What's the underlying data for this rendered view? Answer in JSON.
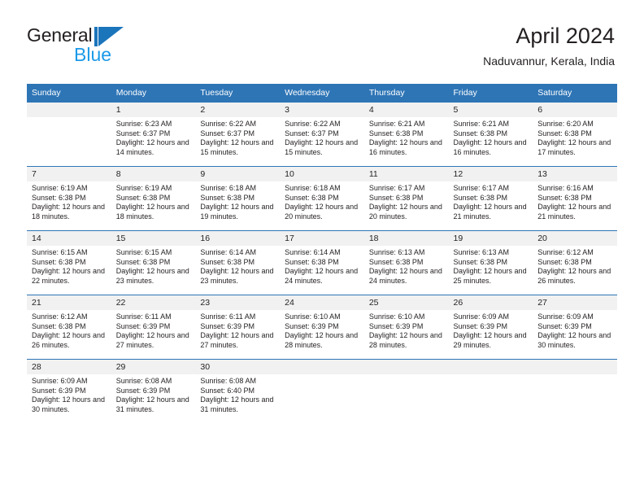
{
  "brand": {
    "name_dark": "General",
    "name_light": "Blue",
    "accent_color": "#1b75bb",
    "light_accent_color": "#1b9ae8"
  },
  "header": {
    "title": "April 2024",
    "subtitle": "Naduvannur, Kerala, India",
    "header_bg_color": "#2e75b6",
    "daynum_bg_color": "#f1f1f1"
  },
  "weekday_headers": [
    "Sunday",
    "Monday",
    "Tuesday",
    "Wednesday",
    "Thursday",
    "Friday",
    "Saturday"
  ],
  "weeks": [
    [
      {
        "empty": true,
        "day": "",
        "sunrise": "",
        "sunset": "",
        "daylight": ""
      },
      {
        "empty": false,
        "day": "1",
        "sunrise": "Sunrise: 6:23 AM",
        "sunset": "Sunset: 6:37 PM",
        "daylight": "Daylight: 12 hours and 14 minutes."
      },
      {
        "empty": false,
        "day": "2",
        "sunrise": "Sunrise: 6:22 AM",
        "sunset": "Sunset: 6:37 PM",
        "daylight": "Daylight: 12 hours and 15 minutes."
      },
      {
        "empty": false,
        "day": "3",
        "sunrise": "Sunrise: 6:22 AM",
        "sunset": "Sunset: 6:37 PM",
        "daylight": "Daylight: 12 hours and 15 minutes."
      },
      {
        "empty": false,
        "day": "4",
        "sunrise": "Sunrise: 6:21 AM",
        "sunset": "Sunset: 6:38 PM",
        "daylight": "Daylight: 12 hours and 16 minutes."
      },
      {
        "empty": false,
        "day": "5",
        "sunrise": "Sunrise: 6:21 AM",
        "sunset": "Sunset: 6:38 PM",
        "daylight": "Daylight: 12 hours and 16 minutes."
      },
      {
        "empty": false,
        "day": "6",
        "sunrise": "Sunrise: 6:20 AM",
        "sunset": "Sunset: 6:38 PM",
        "daylight": "Daylight: 12 hours and 17 minutes."
      }
    ],
    [
      {
        "empty": false,
        "day": "7",
        "sunrise": "Sunrise: 6:19 AM",
        "sunset": "Sunset: 6:38 PM",
        "daylight": "Daylight: 12 hours and 18 minutes."
      },
      {
        "empty": false,
        "day": "8",
        "sunrise": "Sunrise: 6:19 AM",
        "sunset": "Sunset: 6:38 PM",
        "daylight": "Daylight: 12 hours and 18 minutes."
      },
      {
        "empty": false,
        "day": "9",
        "sunrise": "Sunrise: 6:18 AM",
        "sunset": "Sunset: 6:38 PM",
        "daylight": "Daylight: 12 hours and 19 minutes."
      },
      {
        "empty": false,
        "day": "10",
        "sunrise": "Sunrise: 6:18 AM",
        "sunset": "Sunset: 6:38 PM",
        "daylight": "Daylight: 12 hours and 20 minutes."
      },
      {
        "empty": false,
        "day": "11",
        "sunrise": "Sunrise: 6:17 AM",
        "sunset": "Sunset: 6:38 PM",
        "daylight": "Daylight: 12 hours and 20 minutes."
      },
      {
        "empty": false,
        "day": "12",
        "sunrise": "Sunrise: 6:17 AM",
        "sunset": "Sunset: 6:38 PM",
        "daylight": "Daylight: 12 hours and 21 minutes."
      },
      {
        "empty": false,
        "day": "13",
        "sunrise": "Sunrise: 6:16 AM",
        "sunset": "Sunset: 6:38 PM",
        "daylight": "Daylight: 12 hours and 21 minutes."
      }
    ],
    [
      {
        "empty": false,
        "day": "14",
        "sunrise": "Sunrise: 6:15 AM",
        "sunset": "Sunset: 6:38 PM",
        "daylight": "Daylight: 12 hours and 22 minutes."
      },
      {
        "empty": false,
        "day": "15",
        "sunrise": "Sunrise: 6:15 AM",
        "sunset": "Sunset: 6:38 PM",
        "daylight": "Daylight: 12 hours and 23 minutes."
      },
      {
        "empty": false,
        "day": "16",
        "sunrise": "Sunrise: 6:14 AM",
        "sunset": "Sunset: 6:38 PM",
        "daylight": "Daylight: 12 hours and 23 minutes."
      },
      {
        "empty": false,
        "day": "17",
        "sunrise": "Sunrise: 6:14 AM",
        "sunset": "Sunset: 6:38 PM",
        "daylight": "Daylight: 12 hours and 24 minutes."
      },
      {
        "empty": false,
        "day": "18",
        "sunrise": "Sunrise: 6:13 AM",
        "sunset": "Sunset: 6:38 PM",
        "daylight": "Daylight: 12 hours and 24 minutes."
      },
      {
        "empty": false,
        "day": "19",
        "sunrise": "Sunrise: 6:13 AM",
        "sunset": "Sunset: 6:38 PM",
        "daylight": "Daylight: 12 hours and 25 minutes."
      },
      {
        "empty": false,
        "day": "20",
        "sunrise": "Sunrise: 6:12 AM",
        "sunset": "Sunset: 6:38 PM",
        "daylight": "Daylight: 12 hours and 26 minutes."
      }
    ],
    [
      {
        "empty": false,
        "day": "21",
        "sunrise": "Sunrise: 6:12 AM",
        "sunset": "Sunset: 6:38 PM",
        "daylight": "Daylight: 12 hours and 26 minutes."
      },
      {
        "empty": false,
        "day": "22",
        "sunrise": "Sunrise: 6:11 AM",
        "sunset": "Sunset: 6:39 PM",
        "daylight": "Daylight: 12 hours and 27 minutes."
      },
      {
        "empty": false,
        "day": "23",
        "sunrise": "Sunrise: 6:11 AM",
        "sunset": "Sunset: 6:39 PM",
        "daylight": "Daylight: 12 hours and 27 minutes."
      },
      {
        "empty": false,
        "day": "24",
        "sunrise": "Sunrise: 6:10 AM",
        "sunset": "Sunset: 6:39 PM",
        "daylight": "Daylight: 12 hours and 28 minutes."
      },
      {
        "empty": false,
        "day": "25",
        "sunrise": "Sunrise: 6:10 AM",
        "sunset": "Sunset: 6:39 PM",
        "daylight": "Daylight: 12 hours and 28 minutes."
      },
      {
        "empty": false,
        "day": "26",
        "sunrise": "Sunrise: 6:09 AM",
        "sunset": "Sunset: 6:39 PM",
        "daylight": "Daylight: 12 hours and 29 minutes."
      },
      {
        "empty": false,
        "day": "27",
        "sunrise": "Sunrise: 6:09 AM",
        "sunset": "Sunset: 6:39 PM",
        "daylight": "Daylight: 12 hours and 30 minutes."
      }
    ],
    [
      {
        "empty": false,
        "day": "28",
        "sunrise": "Sunrise: 6:09 AM",
        "sunset": "Sunset: 6:39 PM",
        "daylight": "Daylight: 12 hours and 30 minutes."
      },
      {
        "empty": false,
        "day": "29",
        "sunrise": "Sunrise: 6:08 AM",
        "sunset": "Sunset: 6:39 PM",
        "daylight": "Daylight: 12 hours and 31 minutes."
      },
      {
        "empty": false,
        "day": "30",
        "sunrise": "Sunrise: 6:08 AM",
        "sunset": "Sunset: 6:40 PM",
        "daylight": "Daylight: 12 hours and 31 minutes."
      },
      {
        "empty": true,
        "day": "",
        "sunrise": "",
        "sunset": "",
        "daylight": ""
      },
      {
        "empty": true,
        "day": "",
        "sunrise": "",
        "sunset": "",
        "daylight": ""
      },
      {
        "empty": true,
        "day": "",
        "sunrise": "",
        "sunset": "",
        "daylight": ""
      },
      {
        "empty": true,
        "day": "",
        "sunrise": "",
        "sunset": "",
        "daylight": ""
      }
    ]
  ]
}
